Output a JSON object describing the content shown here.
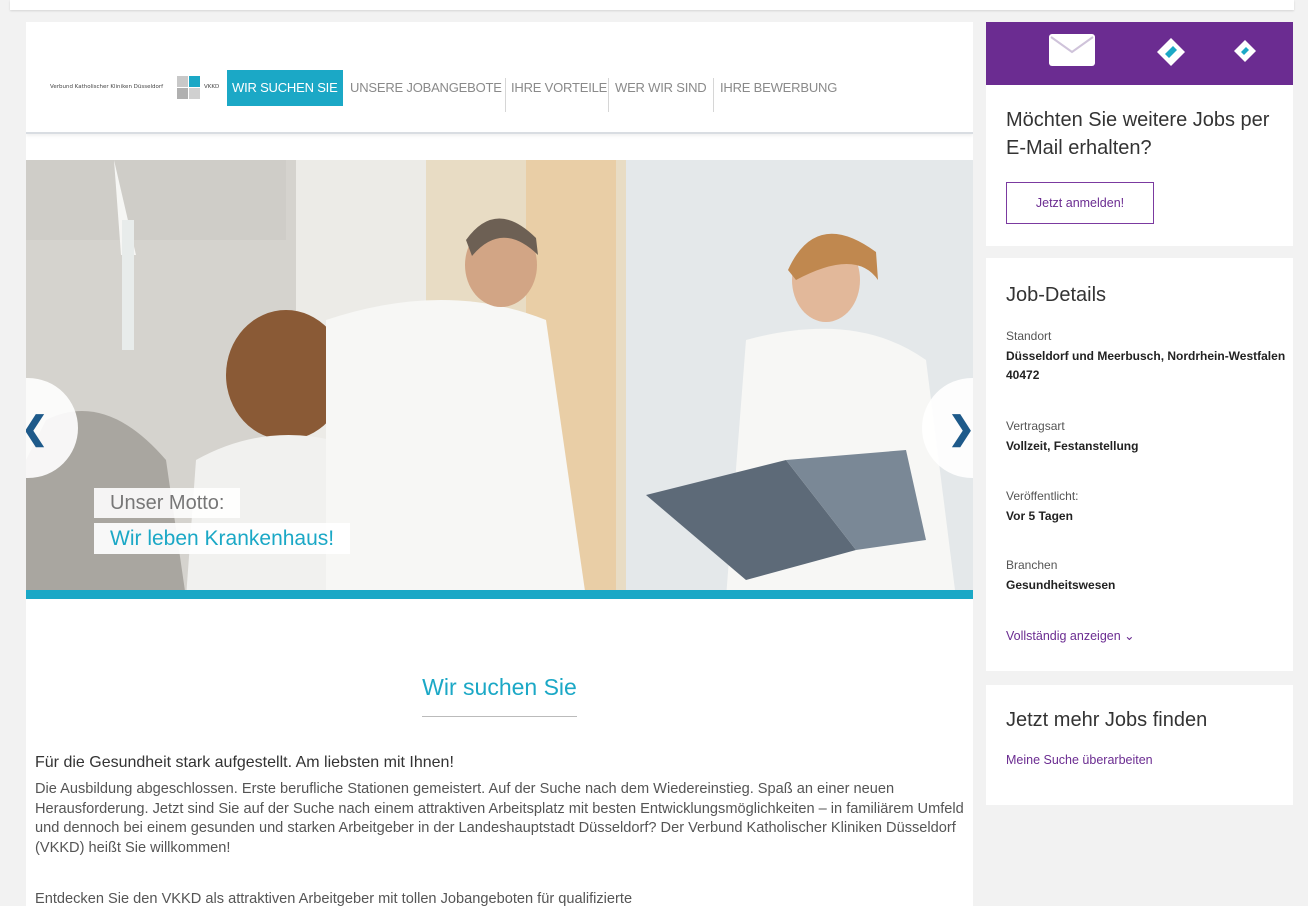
{
  "logo": {
    "name": "Verbund Katholischer Kliniken Düsseldorf",
    "abbr": "VKKD"
  },
  "nav": {
    "items": [
      {
        "label": "WIR SUCHEN SIE",
        "active": true
      },
      {
        "label": "UNSERE JOBANGEBOTE",
        "active": false
      },
      {
        "label": "IHRE VORTEILE",
        "active": false
      },
      {
        "label": "WER WIR SIND",
        "active": false
      },
      {
        "label": "IHRE BEWERBUNG",
        "active": false
      }
    ]
  },
  "hero": {
    "prev_symbol": "❮",
    "next_symbol": "❯",
    "motto_line1": "Unser Motto:",
    "motto_line2": "Wir leben Krankenhaus!"
  },
  "content": {
    "title": "Wir suchen Sie",
    "subhead": "Für die Gesundheit stark aufgestellt. Am liebsten mit Ihnen!",
    "paragraph1": "Die Ausbildung abgeschlossen. Erste berufliche Stationen gemeistert. Auf der Suche nach dem Wiedereinstieg. Spaß an einer neuen Herausforderung. Jetzt sind Sie auf der Suche nach einem attraktiven Arbeitsplatz mit besten Entwicklungsmöglichkeiten – in familiärem Umfeld und dennoch bei einem gesunden und starken Arbeitgeber in der Landeshauptstadt Düsseldorf? Der Verbund Katholischer Kliniken Düsseldorf (VKKD) heißt Sie willkommen!",
    "paragraph2": "Entdecken Sie den VKKD als attraktiven Arbeitgeber mit tollen Jobangeboten für qualifizierte"
  },
  "sidebar": {
    "alert": {
      "title": "Möchten Sie weitere Jobs per E-Mail erhalten?",
      "button": "Jetzt anmelden!"
    },
    "details": {
      "title": "Job-Details",
      "location_label": "Standort",
      "location_value": "Düsseldorf und Meerbusch, Nordrhein-Westfalen 40472",
      "contract_label": "Vertragsart",
      "contract_value": "Vollzeit, Festanstellung",
      "published_label": "Veröffentlicht:",
      "published_value": "Vor 5 Tagen",
      "industry_label": "Branchen",
      "industry_value": "Gesundheitswesen",
      "show_more": "Vollständig anzeigen ⌄"
    },
    "more_jobs": {
      "title": "Jetzt mehr Jobs finden",
      "link": "Meine Suche überarbeiten"
    }
  },
  "colors": {
    "accent": "#1ba8c6",
    "purple": "#6b2c91"
  },
  "icons": [
    "mail-icon",
    "tag-icon",
    "tag-icon",
    "chevron-left-icon",
    "chevron-right-icon",
    "chevron-down-icon"
  ]
}
